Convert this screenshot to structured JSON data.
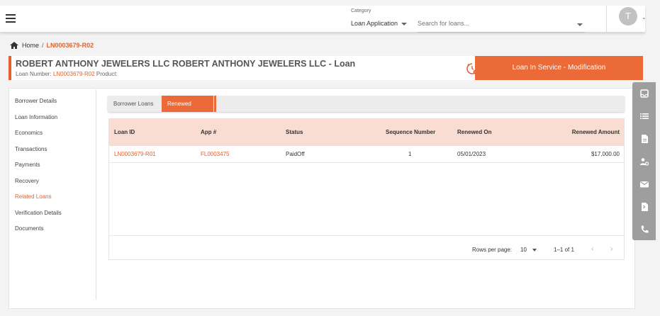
{
  "topbar": {
    "category_label": "Category",
    "category_value": "Loan Application",
    "search_placeholder": "Search for loans...",
    "avatar_initial": "T"
  },
  "breadcrumb": {
    "home": "Home",
    "separator": "/",
    "current": "LN0003679-R02"
  },
  "header": {
    "title": "ROBERT ANTHONY JEWELERS LLC ROBERT ANTHONY JEWELERS LLC - Loan",
    "loan_number_label": "Loan Number:",
    "loan_number": "LN0003679-R02",
    "product_label": "Product:",
    "status": "Loan In Service - Modification"
  },
  "sidebar": {
    "items": [
      {
        "label": "Borrower Details",
        "active": false
      },
      {
        "label": "Loan Information",
        "active": false
      },
      {
        "label": "Economics",
        "active": false
      },
      {
        "label": "Transactions",
        "active": false
      },
      {
        "label": "Payments",
        "active": false
      },
      {
        "label": "Recovery",
        "active": false
      },
      {
        "label": "Related Loans",
        "active": true
      },
      {
        "label": "Verification Details",
        "active": false
      },
      {
        "label": "Documents",
        "active": false
      }
    ]
  },
  "tabs": [
    {
      "label": "Borrower Loans",
      "active": false
    },
    {
      "label": "Renewed Loans",
      "active": true
    }
  ],
  "table": {
    "columns": [
      "Loan ID",
      "App #",
      "Status",
      "Sequence Number",
      "Renewed On",
      "Renewed Amount"
    ],
    "rows": [
      {
        "loan_id": "LN0003679-R01",
        "app": "FL0003475",
        "status": "PaidOff",
        "sequence": "1",
        "renewed_on": "05/01/2023",
        "amount": "$17,000.00"
      }
    ]
  },
  "pagination": {
    "rows_per_page_label": "Rows per page:",
    "rows_per_page": "10",
    "range": "1–1 of 1",
    "prev": "‹",
    "next": "›"
  },
  "colors": {
    "accent": "#e2612d",
    "status_pill": "#ec6a38",
    "table_header": "#f9dcd2",
    "toolbar": "#9e9e9e"
  },
  "icons": {
    "right_toolbar": [
      "inbox-icon",
      "list-icon",
      "document-icon",
      "user-settings-icon",
      "mail-icon",
      "file-export-icon",
      "phone-icon"
    ]
  }
}
